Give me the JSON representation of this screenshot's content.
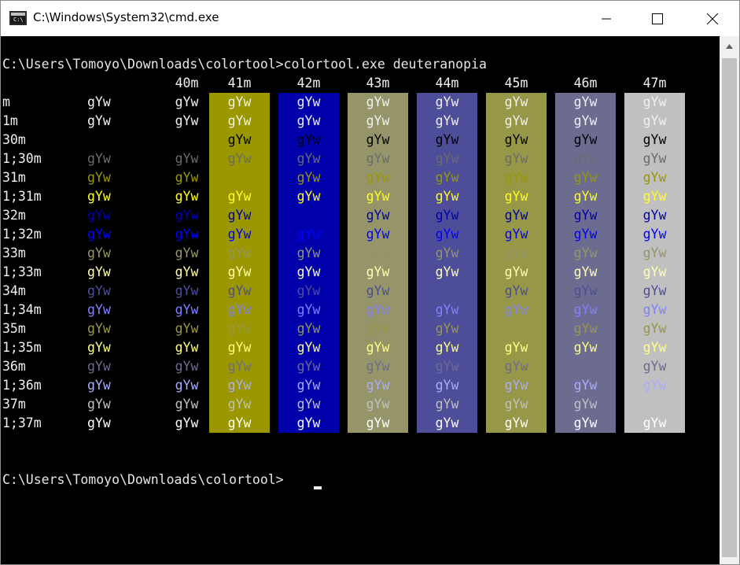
{
  "window": {
    "title": "C:\\Windows\\System32\\cmd.exe",
    "icon": "console-icon",
    "controls": [
      "minimize-icon",
      "maximize-icon",
      "close-icon"
    ]
  },
  "console": {
    "command_line": "C:\\Users\\Tomoyo\\Downloads\\colortool>colortool.exe deuteranopia",
    "prompt_line": "C:\\Users\\Tomoyo\\Downloads\\colortool>",
    "sample_text": "gYw",
    "column_headers": [
      "40m",
      "41m",
      "42m",
      "43m",
      "44m",
      "45m",
      "46m",
      "47m"
    ],
    "row_labels": [
      "m",
      "1m",
      "30m",
      "1;30m",
      "31m",
      "1;31m",
      "32m",
      "1;32m",
      "33m",
      "1;33m",
      "34m",
      "1;34m",
      "35m",
      "1;35m",
      "36m",
      "1;36m",
      "37m",
      "1;37m"
    ],
    "background_colors": [
      "#000000",
      "#9a9700",
      "#0000aa",
      "#959569",
      "#4d4d9a",
      "#979748",
      "#6c6c90",
      "#c0c0c0"
    ],
    "foreground_colors": {
      "default": "#f0f0f0",
      "30m": "#000000",
      "1;30m": "#6b6b6b",
      "31m": "#9a9700",
      "1;31m": "#ffff1a",
      "32m": "#0000aa",
      "1;32m": "#0000ff",
      "33m": "#959569",
      "1;33m": "#ffffb0",
      "34m": "#4d4d9a",
      "1;34m": "#8080ff",
      "35m": "#979748",
      "1;35m": "#ffff80",
      "36m": "#6c6c90",
      "1;36m": "#ababff",
      "37m": "#c0c0c0",
      "1;37m": "#ffffff"
    }
  }
}
